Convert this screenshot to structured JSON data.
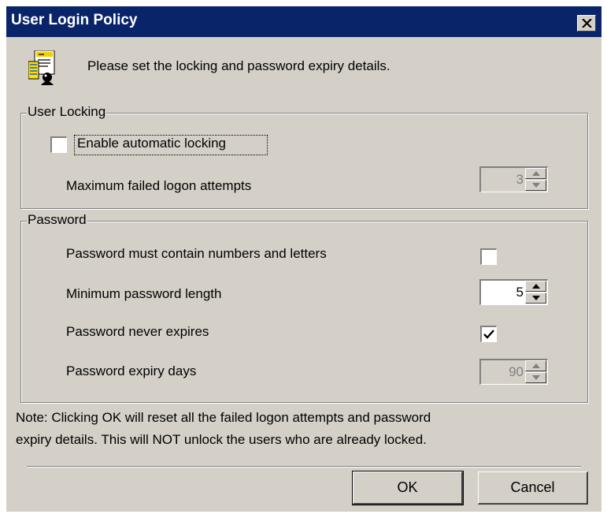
{
  "window": {
    "title": "User Login Policy",
    "close_icon": "close-x-icon"
  },
  "header": {
    "icon": "user-policy-icon",
    "instruction": "Please set the locking and password expiry details."
  },
  "user_locking": {
    "legend": "User Locking",
    "enable_label": "Enable automatic locking",
    "enable_checked": false,
    "max_attempts_label": "Maximum failed logon attempts",
    "max_attempts_value": "3",
    "max_attempts_enabled": false
  },
  "password": {
    "legend": "Password",
    "numbers_letters_label": "Password must contain numbers and letters",
    "numbers_letters_checked": false,
    "min_length_label": "Minimum password length",
    "min_length_value": "5",
    "never_expires_label": "Password never expires",
    "never_expires_checked": true,
    "expiry_days_label": "Password expiry days",
    "expiry_days_value": "90",
    "expiry_days_enabled": false
  },
  "note": {
    "line1": "Note: Clicking OK will reset all the failed logon attempts and password",
    "line2": "expiry details. This will NOT unlock the users who are already locked."
  },
  "buttons": {
    "ok_label": "OK",
    "cancel_label": "Cancel"
  },
  "colors": {
    "title_bar": "#0a246a",
    "dialog_face": "#d4d0c8",
    "disabled_text": "#808080"
  }
}
